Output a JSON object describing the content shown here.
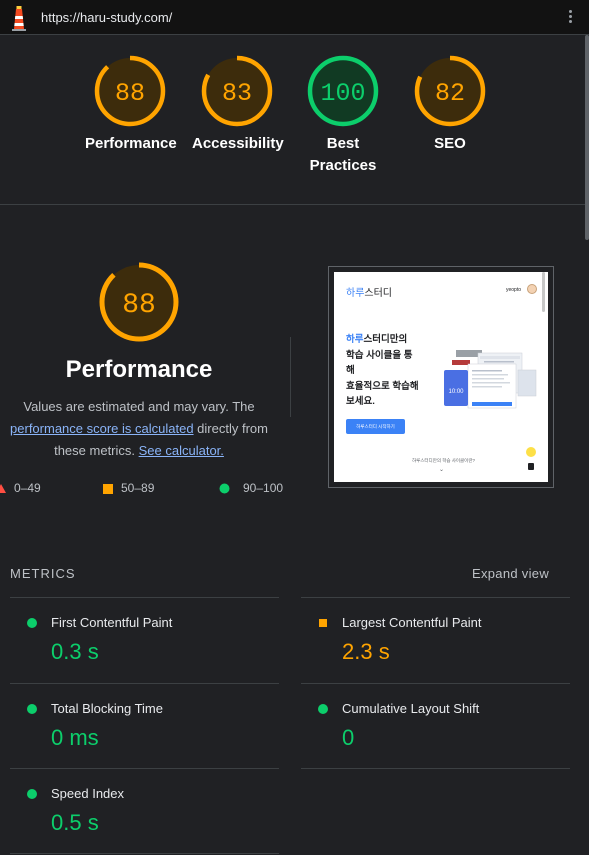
{
  "header": {
    "url": "https://haru-study.com/",
    "logo_icon": "lighthouse-icon",
    "menu_icon": "kebab-menu-icon"
  },
  "colors": {
    "pass": "#0cce6b",
    "average": "#ffa400",
    "fail": "#ff4e42",
    "link": "#8ab4f8"
  },
  "gauges": [
    {
      "label": "Performance",
      "score": "88",
      "rating": "average"
    },
    {
      "label": "Accessibility",
      "score": "83",
      "rating": "average"
    },
    {
      "label": "Best\nPractices",
      "score": "100",
      "rating": "pass"
    },
    {
      "label": "SEO",
      "score": "82",
      "rating": "average"
    }
  ],
  "performance": {
    "score": "88",
    "title": "Performance",
    "desc_1": "Values are estimated and may vary. The",
    "desc_link_1": "performance score is calculated",
    "desc_2": " directly from",
    "desc_3": "these metrics. ",
    "desc_link_2": "See calculator."
  },
  "legend": [
    {
      "range": "0–49",
      "shape": "triangle"
    },
    {
      "range": "50–89",
      "shape": "square"
    },
    {
      "range": "90–100",
      "shape": "circle"
    }
  ],
  "screenshot": {
    "brand_a": "하루",
    "brand_b": "스터디",
    "login": "yeopto",
    "hero_a": "하루",
    "hero_b": "스터디만의",
    "hero_c": "학습 사이클을 통",
    "hero_d": "해",
    "hero_e": "효율적으로 학습해",
    "hero_f": "보세요.",
    "cta": "하루스터디 시작하기",
    "mock_time": "10:00",
    "question": "하루스터디만의 학습 사이클이란?",
    "chevron": "⌄"
  },
  "metrics": {
    "header": "METRICS",
    "expand": "Expand view",
    "items": [
      {
        "label": "First Contentful Paint",
        "value": "0.3 s",
        "rating": "pass"
      },
      {
        "label": "Largest Contentful Paint",
        "value": "2.3 s",
        "rating": "average"
      },
      {
        "label": "Total Blocking Time",
        "value": "0 ms",
        "rating": "pass"
      },
      {
        "label": "Cumulative Layout Shift",
        "value": "0",
        "rating": "pass"
      },
      {
        "label": "Speed Index",
        "value": "0.5 s",
        "rating": "pass"
      }
    ]
  }
}
